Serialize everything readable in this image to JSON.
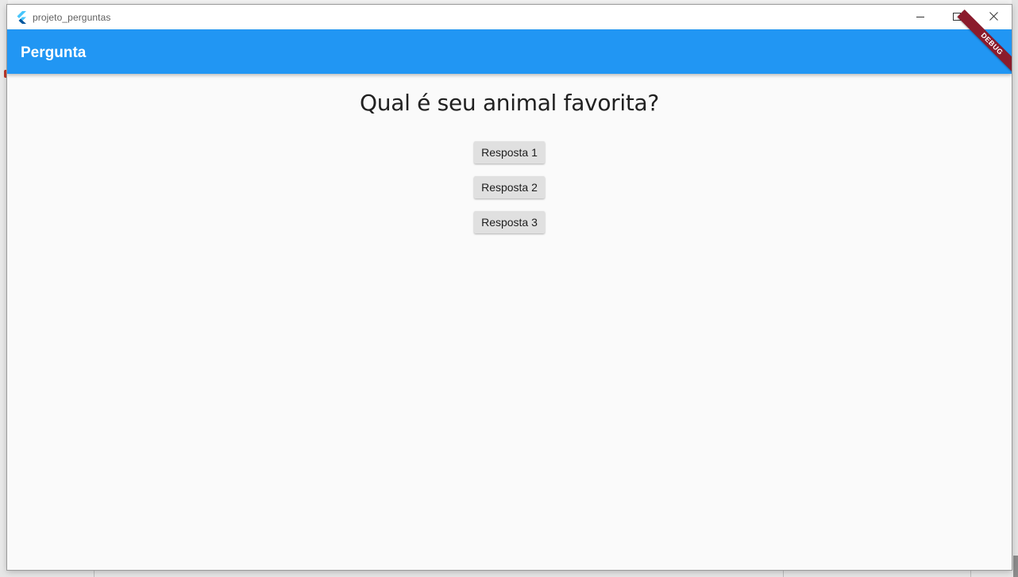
{
  "window": {
    "title": "projeto_perguntas",
    "icon": "flutter-icon"
  },
  "appbar": {
    "title": "Pergunta",
    "color": "#2196f3",
    "debug_banner": "DEBUG"
  },
  "main": {
    "question": "Qual é seu animal favorita?",
    "answers": [
      {
        "label": "Resposta 1"
      },
      {
        "label": "Resposta 2"
      },
      {
        "label": "Resposta 3"
      }
    ]
  }
}
